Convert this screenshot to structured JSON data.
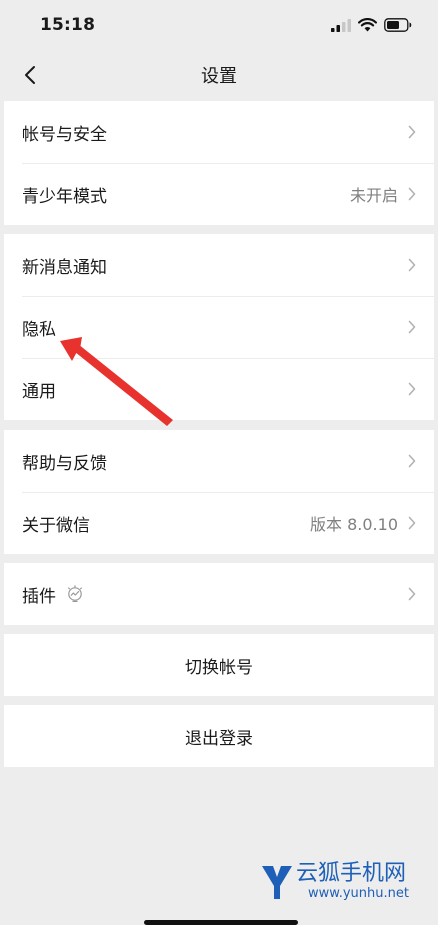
{
  "status_bar": {
    "time": "15:18"
  },
  "nav": {
    "title": "设置"
  },
  "groups": {
    "account": [
      {
        "label": "帐号与安全",
        "value": ""
      },
      {
        "label": "青少年模式",
        "value": "未开启"
      }
    ],
    "notify": [
      {
        "label": "新消息通知",
        "value": ""
      },
      {
        "label": "隐私",
        "value": ""
      },
      {
        "label": "通用",
        "value": ""
      }
    ],
    "about": [
      {
        "label": "帮助与反馈",
        "value": ""
      },
      {
        "label": "关于微信",
        "value": "版本 8.0.10"
      }
    ],
    "plugins": [
      {
        "label": "插件",
        "value": ""
      }
    ]
  },
  "actions": {
    "switch_account": "切换帐号",
    "logout": "退出登录"
  },
  "watermark": {
    "name": "云狐手机网",
    "url": "www.yunhu.net"
  },
  "colors": {
    "annotation": "#e8322e",
    "watermark": "#1e5fb8",
    "background": "#ededed"
  }
}
